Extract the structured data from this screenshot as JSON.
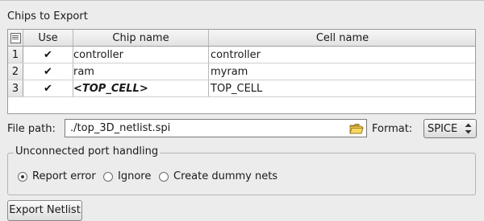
{
  "section_title": "Chips to Export",
  "table": {
    "headers": {
      "use": "Use",
      "chip_name": "Chip name",
      "cell_name": "Cell name"
    },
    "rows": [
      {
        "num": "1",
        "use": true,
        "chip_name": "controller",
        "cell_name": "controller"
      },
      {
        "num": "2",
        "use": true,
        "chip_name": "ram",
        "cell_name": "myram"
      },
      {
        "num": "3",
        "use": true,
        "chip_name": "<TOP_CELL>",
        "cell_name": "TOP_CELL"
      }
    ]
  },
  "file_path": {
    "label": "File path:",
    "value": "./top_3D_netlist.spi"
  },
  "format": {
    "label": "Format:",
    "selected": "SPICE"
  },
  "unconnected": {
    "title": "Unconnected port handling",
    "options": [
      {
        "label": "Report error",
        "selected": true
      },
      {
        "label": "Ignore",
        "selected": false
      },
      {
        "label": "Create dummy nets",
        "selected": false
      }
    ]
  },
  "export_button": "Export Netlist"
}
